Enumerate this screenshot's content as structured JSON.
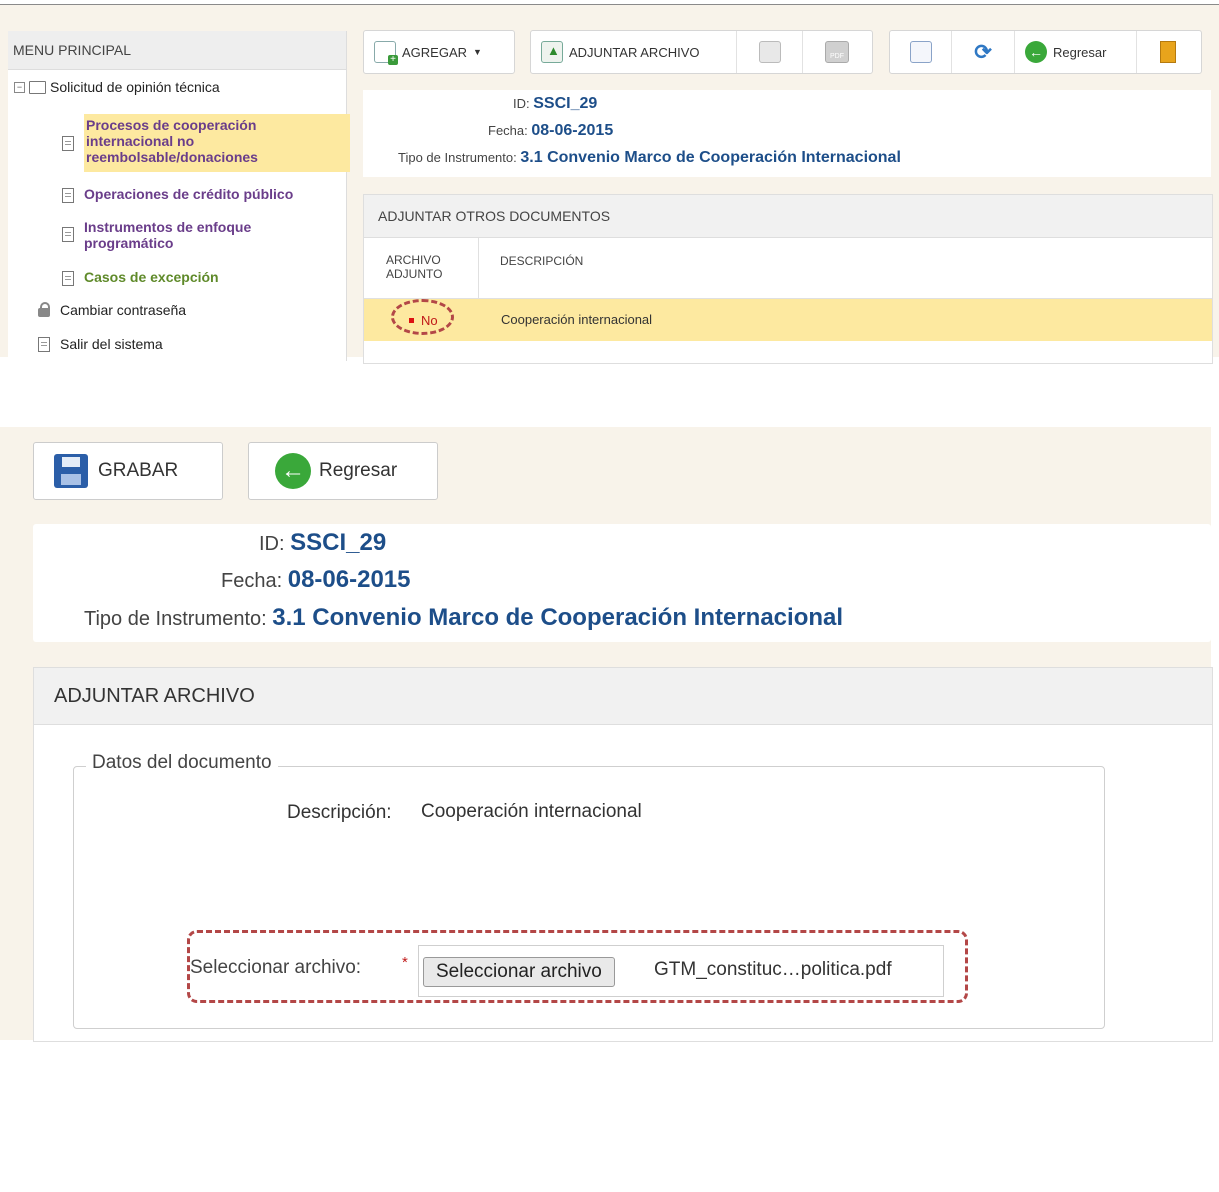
{
  "top": {
    "menu": {
      "header": "MENU PRINCIPAL",
      "root": "Solicitud de opinión técnica",
      "items": [
        {
          "label": "Procesos de cooperación internacional no reembolsable/donaciones",
          "color": "#6a3d8a",
          "selected": true
        },
        {
          "label": "Operaciones de crédito público",
          "color": "#6a3d8a"
        },
        {
          "label": "Instrumentos de enfoque programático",
          "color": "#6a3d8a"
        },
        {
          "label": "Casos de excepción",
          "color": "#5f8a2a"
        }
      ],
      "change_password": "Cambiar contraseña",
      "logout": "Salir del sistema"
    },
    "toolbar": {
      "add_label": "AGREGAR",
      "attach_label": "ADJUNTAR ARCHIVO",
      "back_label": "Regresar"
    },
    "info": {
      "id_label": "ID:",
      "id_value": "SSCI_29",
      "date_label": "Fecha:",
      "date_value": "08-06-2015",
      "type_label": "Tipo de Instrumento:",
      "type_value": "3.1 Convenio Marco de Cooperación Internacional"
    },
    "panel": {
      "title": "ADJUNTAR OTROS DOCUMENTOS",
      "col_attached_line1": "ARCHIVO",
      "col_attached_line2": "ADJUNTO",
      "col_description": "DESCRIPCIÓN",
      "row": {
        "attached": "No",
        "description": "Cooperación internacional"
      }
    }
  },
  "bottom": {
    "save_label": "GRABAR",
    "back_label": "Regresar",
    "info": {
      "id_label": "ID:",
      "id_value": "SSCI_29",
      "date_label": "Fecha:",
      "date_value": "08-06-2015",
      "type_label": "Tipo de Instrumento:",
      "type_value": "3.1 Convenio Marco de Cooperación Internacional"
    },
    "panel_title": "ADJUNTAR ARCHIVO",
    "fieldset_legend": "Datos del documento",
    "description_label": "Descripción:",
    "description_value": "Cooperación internacional",
    "file_label": "Seleccionar archivo:",
    "required_mark": "*",
    "file_button": "Seleccionar archivo",
    "file_name": "GTM_constituc…politica.pdf"
  },
  "colors": {
    "accent_blue": "#1d4e89",
    "highlight": "#fde9a0",
    "dashed_red": "#b34747"
  }
}
